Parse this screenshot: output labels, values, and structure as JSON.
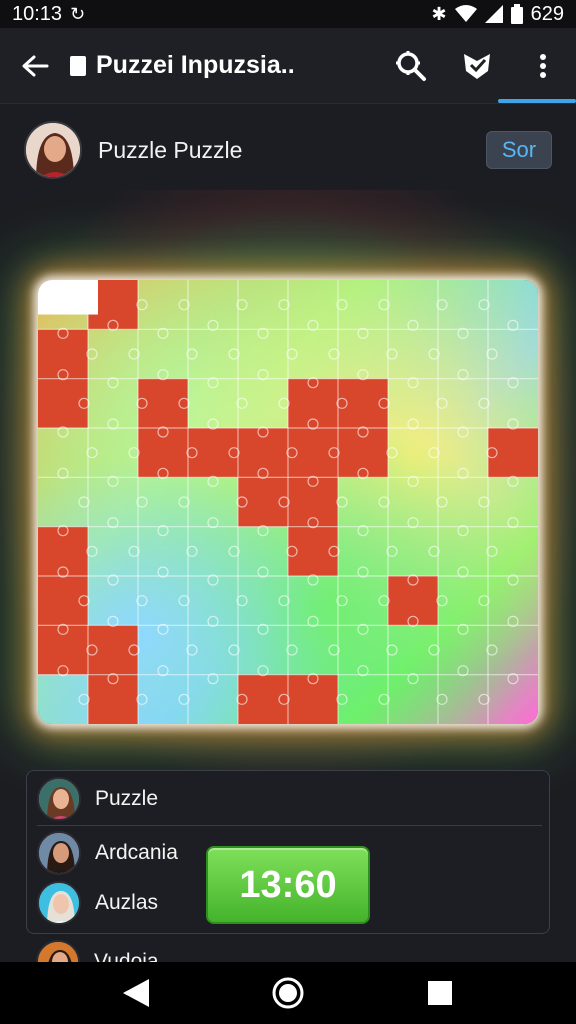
{
  "status_bar": {
    "time": "10:13",
    "battery_text": "629",
    "icons": [
      "sync-icon",
      "bluetooth-icon",
      "wifi-icon",
      "signal-icon",
      "battery-icon"
    ]
  },
  "app_bar": {
    "title": "Puzzei Inpuzsia..",
    "icons": [
      "back-arrow-icon",
      "search-icon",
      "bookmark-icon",
      "more-vert-icon"
    ],
    "accent": "#3fa4e8"
  },
  "profile": {
    "name": "Puzzle Puzzle",
    "sort_label": "Sor"
  },
  "puzzle": {
    "rows": 9,
    "cols": 10,
    "placed_piece_color": "#d8472c"
  },
  "players": [
    {
      "name": "Puzzle"
    },
    {
      "name": "Ardcania"
    },
    {
      "name": "Auzlas"
    },
    {
      "name": "Vudoia"
    }
  ],
  "timer": {
    "value": "13:60",
    "color": "#5ccb3c"
  },
  "nav_bar": {
    "icons": [
      "back-triangle-icon",
      "home-circle-icon",
      "recents-square-icon"
    ]
  }
}
